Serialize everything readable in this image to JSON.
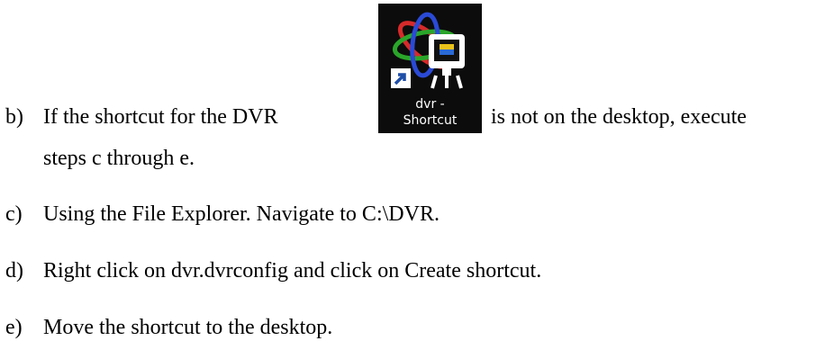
{
  "shortcut_icon": {
    "name": "dvr-shortcut-icon",
    "caption_line1": "dvr -",
    "caption_line2": "Shortcut",
    "overlay_icon": "shortcut-arrow-icon"
  },
  "steps": [
    {
      "marker": "b)",
      "text_before": "If the shortcut for the DVR",
      "text_after": "is not on the desktop, execute",
      "text_cont": "steps c through e."
    },
    {
      "marker": "c)",
      "text": "Using the File Explorer. Navigate to C:\\DVR."
    },
    {
      "marker": "d)",
      "text": "Right click on dvr.dvrconfig and click on Create shortcut."
    },
    {
      "marker": "e)",
      "text": "Move the shortcut to the desktop."
    }
  ]
}
